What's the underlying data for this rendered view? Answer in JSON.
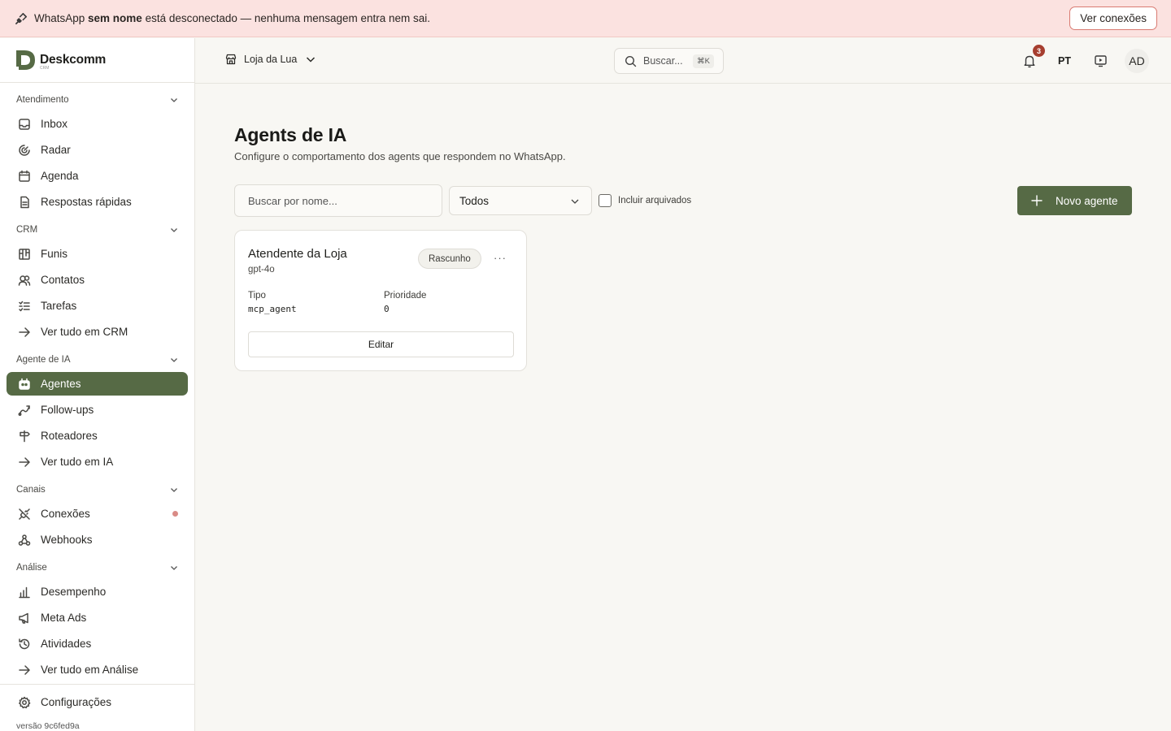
{
  "banner": {
    "prefix": "WhatsApp ",
    "name": "sem nome",
    "suffix": " está desconectado — nenhuma mensagem entra nem sai.",
    "button": "Ver conexões"
  },
  "brand": {
    "name": "Deskcomm",
    "tagline": "CRM",
    "accent": "#566a45"
  },
  "sidebar": {
    "groups": [
      {
        "title": "Atendimento",
        "items": [
          "Inbox",
          "Radar",
          "Agenda",
          "Respostas rápidas"
        ]
      },
      {
        "title": "CRM",
        "items": [
          "Funis",
          "Contatos",
          "Tarefas",
          "Ver tudo em CRM"
        ]
      },
      {
        "title": "Agente de IA",
        "items": [
          "Agentes",
          "Follow-ups",
          "Roteadores",
          "Ver tudo em IA"
        ]
      },
      {
        "title": "Canais",
        "items": [
          "Conexões",
          "Webhooks"
        ]
      },
      {
        "title": "Análise",
        "items": [
          "Desempenho",
          "Meta Ads",
          "Atividades",
          "Ver tudo em Análise"
        ]
      }
    ],
    "active_item": "Agentes",
    "settings": "Configurações",
    "version": "versão 9c6fed9a"
  },
  "header": {
    "store": "Loja da Lua",
    "search_placeholder": "Buscar...",
    "search_shortcut": "⌘K",
    "notifications_count": "3",
    "language": "PT",
    "avatar_initials": "AD"
  },
  "main": {
    "title": "Agents de IA",
    "subtitle": "Configure o comportamento dos agents que respondem no WhatsApp.",
    "filter_search_placeholder": "Buscar por nome...",
    "filter_select": "Todos",
    "include_archived": "Incluir arquivados",
    "include_archived_checked": false,
    "new_button": "Novo agente"
  },
  "agents": [
    {
      "name": "Atendente da Loja",
      "model": "gpt-4o",
      "status": "Rascunho",
      "menu": "···",
      "type_label": "Tipo",
      "type": "mcp_agent",
      "priority_label": "Prioridade",
      "priority": "0",
      "edit": "Editar"
    }
  ]
}
